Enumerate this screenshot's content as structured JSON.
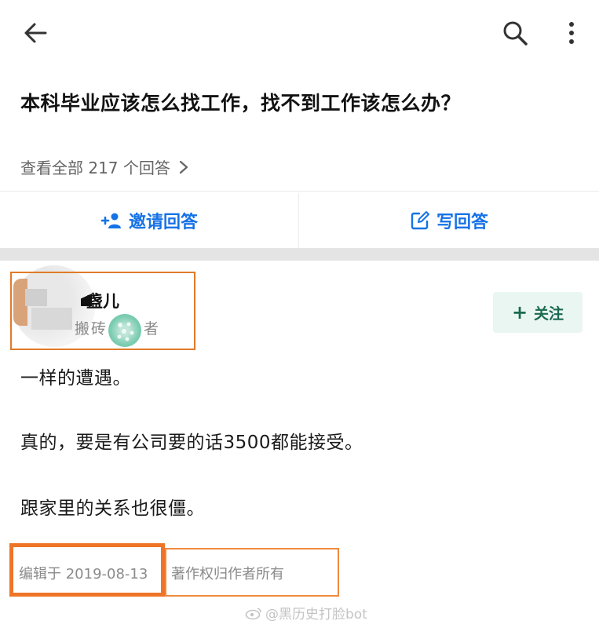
{
  "question": {
    "title": "本科毕业应该怎么找工作，找不到工作该怎么办？",
    "view_all_label": "查看全部 217 个回答"
  },
  "actions": {
    "invite_label": "邀请回答",
    "write_label": "写回答",
    "accent_color": "#1772e6"
  },
  "author": {
    "name": "盏儿",
    "headline_prefix": "搬砖",
    "headline_suffix": "者",
    "follow_label": "关注"
  },
  "answer": {
    "paragraphs": [
      "一样的遭遇。",
      "真的，要是有公司要的话3500都能接受。",
      "跟家里的关系也很僵。"
    ],
    "edited": "编辑于 2019-08-13",
    "copyright": "著作权归作者所有"
  },
  "watermark": {
    "text": "@黑历史打脸bot"
  },
  "icons": [
    "back-arrow-icon",
    "search-icon",
    "more-vertical-icon",
    "invite-person-icon",
    "edit-icon",
    "chevron-right-icon",
    "plus-icon",
    "weibo-icon"
  ],
  "highlight_color": "#ee7527"
}
